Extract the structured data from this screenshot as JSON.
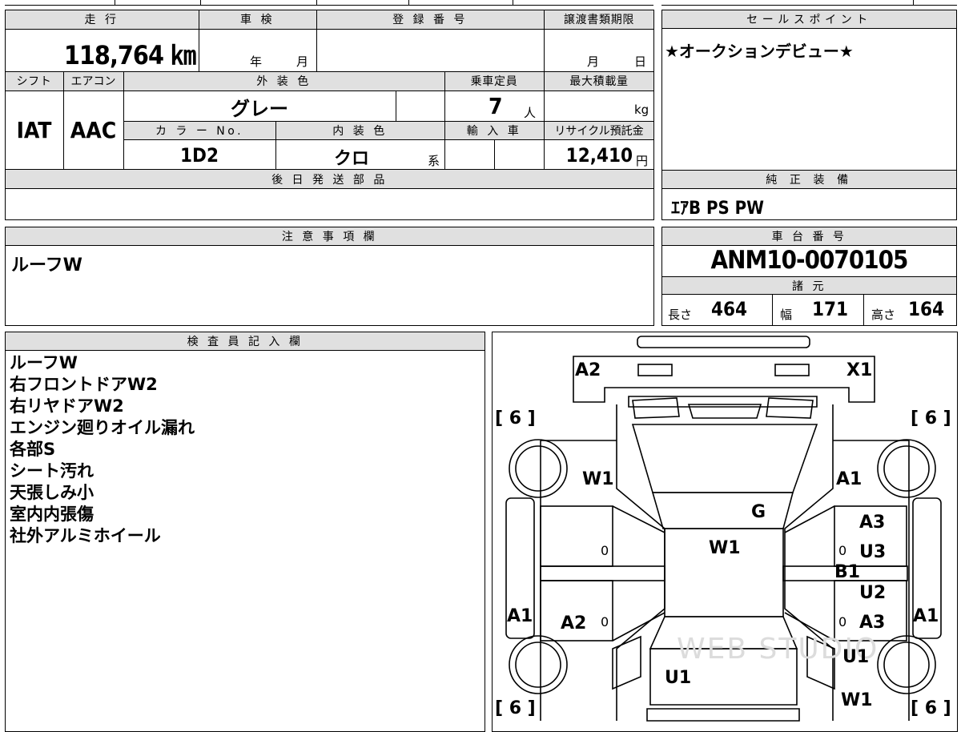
{
  "main": {
    "mileage_label": "走 行",
    "mileage": "118,764 ㎞",
    "inspection_label": "車 検",
    "inspection_year": "年",
    "inspection_month": "月",
    "registration_label": "登 録 番 号",
    "transfer_label": "譲渡書類期限",
    "transfer_month": "月",
    "transfer_day": "日",
    "shift_label": "シフト",
    "shift": "IAT",
    "aircon_label": "エアコン",
    "aircon": "AAC",
    "exterior_color_label": "外 装 色",
    "exterior_color": "グレー",
    "capacity_label": "乗車定員",
    "capacity": "7",
    "capacity_unit": "人",
    "max_load_label": "最大積載量",
    "max_load_unit": "kg",
    "color_no_label": "カ ラ ー No.",
    "color_no": "1D2",
    "interior_color_label": "内 装 色",
    "interior_color": "クロ",
    "interior_color_suffix": "系",
    "import_label": "輸 入 車",
    "recycle_label": "リサイクル預託金",
    "recycle_fee": "12,410",
    "recycle_unit": "円",
    "later_parts_label": "後 日 発 送 部 品"
  },
  "selling_points": {
    "label": "セールスポイント",
    "text": "★オークションデビュー★"
  },
  "equipment": {
    "label": "純 正 装 備",
    "text": "ｴｱB PS PW"
  },
  "notes": {
    "label": "注 意 事 項 欄",
    "text": "ルーフW"
  },
  "chassis": {
    "label": "車 台 番 号",
    "number": "ANM10-0070105",
    "specs_label": "諸 元",
    "length_label": "長さ",
    "length": "464",
    "width_label": "幅",
    "width": "171",
    "height_label": "高さ",
    "height": "164"
  },
  "inspector": {
    "label": "検 査 員 記 入 欄",
    "lines": [
      "ルーフW",
      "右フロントドアW2",
      "右リヤドアW2",
      "エンジン廻りオイル漏れ",
      "各部S",
      "シート汚れ",
      "天張しみ小",
      "室内内張傷",
      "社外アルミホイール"
    ]
  },
  "diagram": {
    "marks": {
      "a2_top": "A2",
      "x1": "X1",
      "w1_left": "W1",
      "a1_right_top": "A1",
      "g": "G",
      "w1_center": "W1",
      "a3_upper": "A3",
      "u3": "U3",
      "b1": "B1",
      "u2": "U2",
      "a3_lower": "A3",
      "a1_left": "A1",
      "a2_left": "A2",
      "a1_right": "A1",
      "u1_right": "U1",
      "u1_bottom": "U1",
      "w1_bottom": "W1"
    },
    "tire_front_left": "[ 6 ]",
    "tire_front_right": "[ 6 ]",
    "tire_rear_left": "[ 6 ]",
    "tire_rear_right": "[ 6 ]",
    "zero": "0",
    "watermark": "WEB STUDIO"
  }
}
